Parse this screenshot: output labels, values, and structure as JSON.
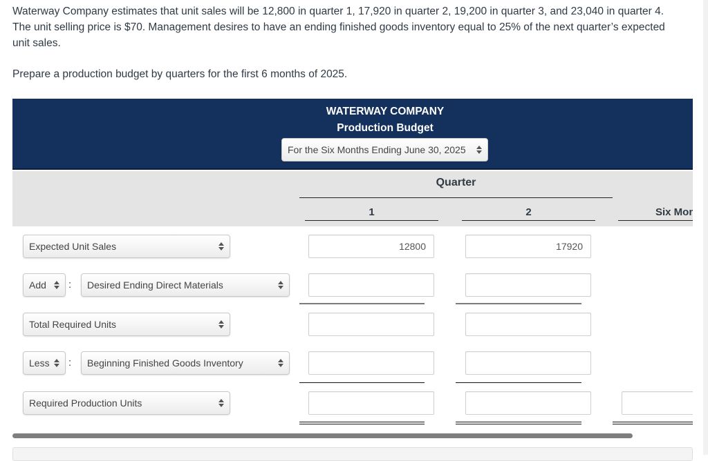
{
  "problem": {
    "text": "Waterway Company estimates that unit sales will be 12,800 in quarter 1, 17,920 in quarter 2, 19,200 in quarter 3, and 23,040 in quarter 4. The unit selling price is $70. Management desires to have an ending finished goods inventory equal to 25% of the next quarter’s expected unit sales.",
    "instruction": "Prepare a production budget by quarters for the first 6 months of 2025."
  },
  "header": {
    "company": "WATERWAY COMPANY",
    "title": "Production Budget",
    "period_select": "For the Six Months Ending June 30, 2025"
  },
  "columns": {
    "group_label": "Quarter",
    "q1": "1",
    "q2": "2",
    "total": "Six Months"
  },
  "rows": [
    {
      "label": "Expected Unit Sales",
      "q1": "12800",
      "q2": "17920",
      "total": ""
    },
    {
      "operator": "Add",
      "label": "Desired Ending Direct Materials",
      "q1": "",
      "q2": ""
    },
    {
      "label": "Total Required Units",
      "q1": "",
      "q2": ""
    },
    {
      "operator": "Less",
      "label": "Beginning Finished Goods Inventory",
      "q1": "",
      "q2": ""
    },
    {
      "label": "Required Production Units",
      "q1": "",
      "q2": "",
      "total": ""
    }
  ],
  "separator": ":"
}
